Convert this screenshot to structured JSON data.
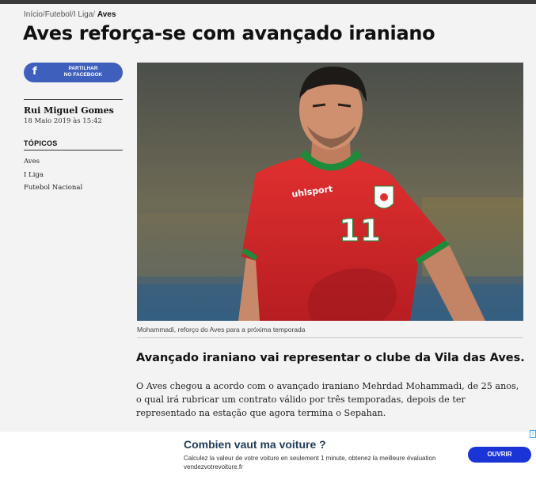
{
  "breadcrumb": {
    "items": [
      "Início",
      "Futebol",
      "I Liga",
      "Aves"
    ],
    "separator": "/"
  },
  "article": {
    "title": "Aves reforça-se com avançado iraniano",
    "share_button": {
      "line1": "PARTILHAR",
      "line2": "NO FACEBOOK",
      "icon_letter": "f"
    },
    "author": "Rui Miguel Gomes",
    "date": "18 Maio 2019 às 15:42",
    "topics_heading": "TÓPICOS",
    "topics": [
      "Aves",
      "I Liga",
      "Futebol Nacional"
    ],
    "photo": {
      "caption": "Mohammadi, reforço do Aves para a próxima temporada",
      "shirt_brand": "uhlsport",
      "shirt_number": "11"
    },
    "subtitle": "Avançado iraniano vai representar o clube da Vila das Aves.",
    "body": "O Aves chegou a acordo com o avançado iraniano Mehrdad Mohammadi, de 25 anos, o qual irá rubricar um contrato válido por três temporadas, depois de ter representado na estação que agora termina o Sepahan."
  },
  "ad": {
    "badge": "i",
    "title": "Combien vaut ma voiture ?",
    "text": "Calculez la valeur de votre voiture en seulement 1 minute, obtenez la meilleure évaluation vendezvotrevoiture.fr",
    "button": "OUVRIR"
  },
  "colors": {
    "facebook": "#3f5fbd",
    "ad_button": "#1a34d6",
    "shirt_red": "#d8272c",
    "shirt_green": "#1f8a3a"
  }
}
